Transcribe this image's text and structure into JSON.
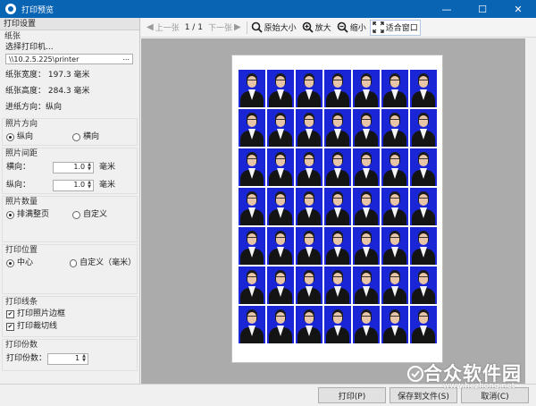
{
  "window": {
    "title": "打印预览",
    "minimize_glyph": "—",
    "maximize_glyph": "☐",
    "close_glyph": "✕"
  },
  "left_panel": {
    "title": "打印设置",
    "paper": {
      "label": "纸张",
      "select_printer": "选择打印机...",
      "printer_path": "\\\\10.2.5.225\\printer",
      "browse_label": "...",
      "width": "纸张宽度：  197.3 毫米",
      "height": "纸张高度：  284.3 毫米",
      "direction": "进纸方向：纵向"
    },
    "orientation": {
      "label": "照片方向",
      "portrait": "纵向",
      "landscape": "横向",
      "selected": "portrait"
    },
    "spacing": {
      "label": "照片间距",
      "horizontal_label": "横向：",
      "horizontal_value": "1.0",
      "vertical_label": "纵向：",
      "vertical_value": "1.0",
      "unit": "毫米"
    },
    "count": {
      "label": "照片数量",
      "full_page": "排满整页",
      "custom": "自定义",
      "selected": "full_page"
    },
    "position": {
      "label": "打印位置",
      "center": "中心",
      "custom": "自定义（毫米）",
      "selected": "center"
    },
    "lines": {
      "label": "打印线条",
      "border": "打印照片边框",
      "cutline": "打印裁切线",
      "border_checked": true,
      "cutline_checked": true
    },
    "copies": {
      "label": "打印份数",
      "field_label": "打印份数：",
      "value": "1"
    }
  },
  "toolbar": {
    "prev": "上一张",
    "page": "1 / 1",
    "next": "下一张",
    "original_size": "原始大小",
    "zoom_in": "放大",
    "zoom_out": "缩小",
    "fit_window": "适合窗口"
  },
  "preview": {
    "rows": 7,
    "cols": 7,
    "photo_background": "#1a26d6",
    "area_background": "#ababab"
  },
  "buttons": {
    "print": "打印(P)",
    "save_file": "保存到文件(S)",
    "cancel": "取消(C)"
  },
  "watermark": {
    "main": "合众软件园",
    "sub": "www.hezhong.net"
  },
  "colors": {
    "titlebar": "#0a64b4"
  }
}
